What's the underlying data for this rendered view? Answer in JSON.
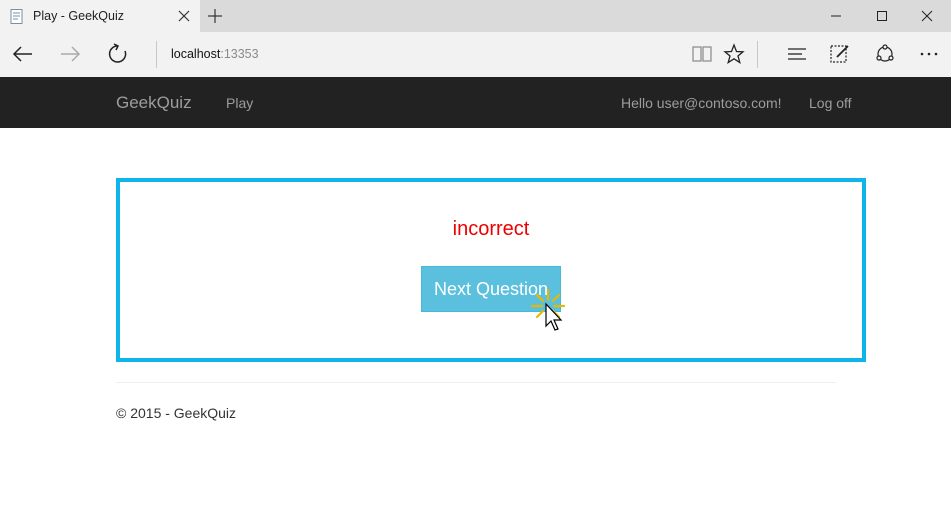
{
  "browser": {
    "tab_title": "Play - GeekQuiz",
    "address_host": "localhost",
    "address_port": ":13353"
  },
  "navbar": {
    "brand": "GeekQuiz",
    "play_link": "Play",
    "greeting": "Hello user@contoso.com!",
    "logoff_link": "Log off"
  },
  "quiz": {
    "result_text": "incorrect",
    "result_color": "#ee0000",
    "next_button_label": "Next Question",
    "panel_border_color": "#0fb5e8",
    "button_color": "#5bc0de"
  },
  "footer": {
    "copyright": "© 2015 - GeekQuiz"
  },
  "icons": {
    "favicon": "page-icon",
    "tab_close": "close-icon",
    "new_tab": "plus-icon",
    "back": "back-arrow-icon",
    "forward": "forward-arrow-icon",
    "refresh": "refresh-icon",
    "reading_view": "book-icon",
    "favorite": "star-icon",
    "hub": "hub-icon",
    "notes": "pen-icon",
    "share": "share-icon",
    "more": "more-icon"
  }
}
